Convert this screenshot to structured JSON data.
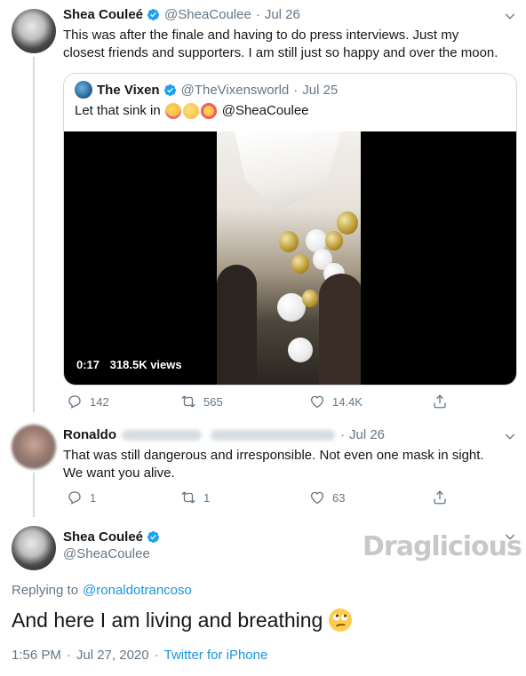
{
  "tweet1": {
    "display_name": "Shea Couleé",
    "handle": "@SheaCoulee",
    "sep": "·",
    "date": "Jul 26",
    "text_line1": "This was after the finale and having to do press interviews. Just my",
    "text_line2": "closest friends and supporters. I am still just so happy and over the moon.",
    "quote": {
      "display_name": "The Vixen",
      "handle": "@TheVixensworld",
      "sep": "·",
      "date": "Jul 25",
      "text_start": "Let that sink in",
      "text_mention": "@SheaCoulee",
      "video_time": "0:17",
      "video_views": "318.5K views"
    },
    "replies": "142",
    "retweets": "565",
    "likes": "14.4K"
  },
  "tweet2": {
    "display_name": "Ronaldo",
    "sep": "·",
    "date": "Jul 26",
    "text_line1": "That was still dangerous and irresponsible. Not even one mask in sight.",
    "text_line2": "We want you alive.",
    "replies": "1",
    "retweets": "1",
    "likes": "63"
  },
  "tweet3": {
    "display_name": "Shea Couleé",
    "handle": "@SheaCoulee",
    "replying_prefix": "Replying to",
    "replying_to": "@ronaldotrancoso",
    "text": "And here I am living and breathing",
    "time": "1:56 PM",
    "sep": "·",
    "date": "Jul 27, 2020",
    "source": "Twitter for iPhone"
  },
  "watermark": "Draglicious",
  "colors": {
    "link": "#1b95e0",
    "verified": "#1da1f2",
    "muted": "#657786",
    "border": "#cfd9de"
  },
  "icons": [
    "verified-icon",
    "chevron-down-icon",
    "reply-icon",
    "retweet-icon",
    "like-icon",
    "share-icon",
    "rolling-eyes-emoji"
  ]
}
